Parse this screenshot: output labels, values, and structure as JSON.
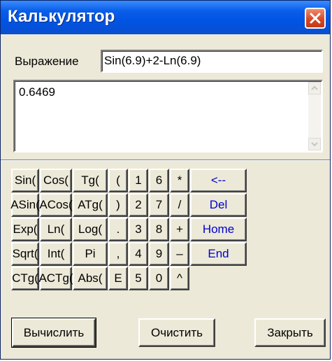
{
  "window": {
    "title": "Калькулятор"
  },
  "expression": {
    "label": "Выражение",
    "value": "Sin(6.9)+2-Ln(6.9)"
  },
  "result": {
    "value": "0.6469"
  },
  "keypad": {
    "row1": [
      "Sin(",
      "Cos(",
      "Tg(",
      "(",
      "1",
      "6",
      "*"
    ],
    "row2": [
      "ASin(",
      "ACos(",
      "ATg(",
      ")",
      "2",
      "7",
      "/"
    ],
    "row3": [
      "Exp(",
      "Ln(",
      "Log(",
      ".",
      "3",
      "8",
      "+"
    ],
    "row4": [
      "Sqrt(",
      "Int(",
      "Pi",
      ",",
      "4",
      "9",
      "–"
    ],
    "row5": [
      "CTg(",
      "ACTg(",
      "Abs(",
      "E",
      "5",
      "0",
      "^"
    ],
    "nav": [
      "<--",
      "Del",
      "Home",
      "End"
    ]
  },
  "buttons": {
    "calculate": "Вычислить",
    "clear": "Очистить",
    "close": "Закрыть"
  },
  "colors": {
    "titlebar": "#0054e3",
    "nav_text": "#0000cc",
    "close_button": "#d64522"
  },
  "icons": {
    "close": "close-icon"
  }
}
